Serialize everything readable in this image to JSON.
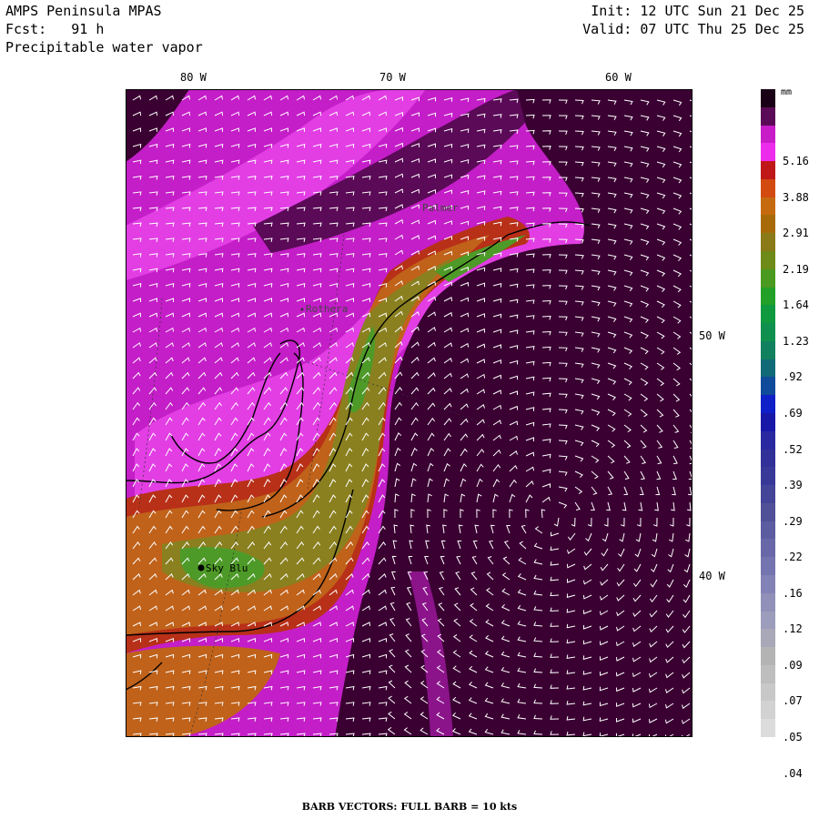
{
  "header": {
    "title": "AMPS Peninsula MPAS",
    "forecast": "Fcst:   91 h",
    "field": "Precipitable water vapor",
    "init": "Init: 12 UTC Sun 21 Dec 25",
    "valid": "Valid: 07 UTC Thu 25 Dec 25"
  },
  "map": {
    "lon_labels": [
      "80 W",
      "70 W",
      "60 W"
    ],
    "lat_labels": [
      "50 W",
      "40 W"
    ],
    "stations": [
      {
        "name": "Sky Blu"
      },
      {
        "name": "Rothera"
      },
      {
        "name": "Palmer"
      }
    ],
    "colors": {
      "dark": "#3a0032",
      "purple": "#8b148a",
      "magenta": "#c41ec8",
      "pink": "#e23ee4",
      "red": "#b83018",
      "orange": "#c0621a",
      "olive": "#8a8020",
      "green": "#4e9a28"
    }
  },
  "colorbar": {
    "unit": "mm",
    "labels": [
      "5.16",
      "3.88",
      "2.91",
      "2.19",
      "1.64",
      "1.23",
      ".92",
      ".69",
      ".52",
      ".39",
      ".29",
      ".22",
      ".16",
      ".12",
      ".09",
      ".07",
      ".05",
      ".04"
    ],
    "colors": [
      "#1a0016",
      "#5a0a56",
      "#c81cc8",
      "#ee2cee",
      "#c01818",
      "#d24a10",
      "#c66a10",
      "#a86a08",
      "#8a7a18",
      "#6e8a18",
      "#4a9a20",
      "#22a028",
      "#109a40",
      "#10904e",
      "#10805e",
      "#106a78",
      "#104a9a",
      "#1020c8",
      "#1818a8",
      "#2828a0",
      "#303098",
      "#383898",
      "#444498",
      "#505098",
      "#5c5ca0",
      "#6868a8",
      "#7474b0",
      "#8282b6",
      "#9090b8",
      "#9c9cbc",
      "#a8a8b8",
      "#b4b4b4",
      "#bebebe",
      "#c8c8c8",
      "#d2d2d2",
      "#dcdcdc"
    ]
  },
  "footer": "BARB VECTORS:  FULL BARB = 10 kts"
}
